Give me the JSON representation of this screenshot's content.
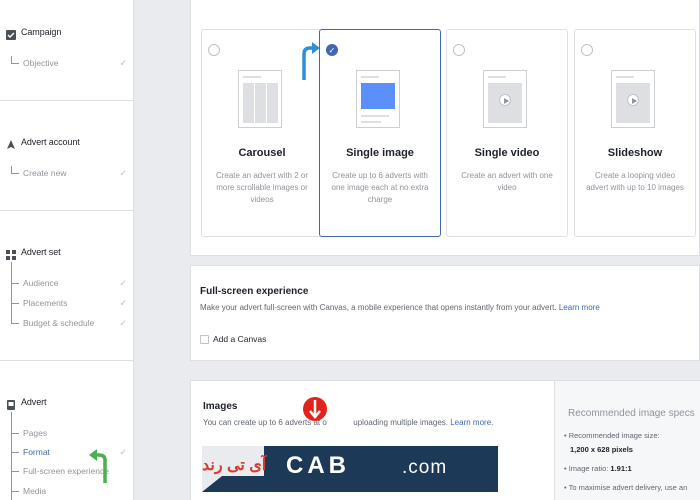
{
  "sidebar": {
    "campaign": {
      "label": "Campaign",
      "items": [
        {
          "label": "Objective"
        }
      ]
    },
    "advert_account": {
      "label": "Advert account",
      "items": [
        {
          "label": "Create new"
        }
      ]
    },
    "advert_set": {
      "label": "Advert set",
      "items": [
        {
          "label": "Audience"
        },
        {
          "label": "Placements"
        },
        {
          "label": "Budget & schedule"
        }
      ]
    },
    "advert": {
      "label": "Advert",
      "items": [
        {
          "label": "Pages"
        },
        {
          "label": "Format",
          "active": true
        },
        {
          "label": "Full-screen experience"
        },
        {
          "label": "Media"
        }
      ]
    },
    "check_glyph": "✓"
  },
  "formats": [
    {
      "title": "Carousel",
      "description": "Create an advert with 2 or more scrollable images or videos",
      "selected": false
    },
    {
      "title": "Single image",
      "description": "Create up to 6 adverts with one image each at no extra charge",
      "selected": true
    },
    {
      "title": "Single video",
      "description": "Create an advert with one video",
      "selected": false
    },
    {
      "title": "Slideshow",
      "description": "Create a looping video advert with up to 10 images",
      "selected": false
    }
  ],
  "fullscreen": {
    "title": "Full-screen experience",
    "description": "Make your advert full-screen with Canvas, a mobile experience that opens instantly from your advert.",
    "learn_more": "Learn more",
    "checkbox_label": "Add a Canvas"
  },
  "images": {
    "title": "Images",
    "description_start": "You can create up to 6 adverts at o",
    "description_end": "uploading multiple images.",
    "learn_more": "Learn more."
  },
  "recommended": {
    "title": "Recommended image specs",
    "size_label": "Recommended image size:",
    "size_value": "1,200 x 628 pixels",
    "ratio_label": "Image ratio:",
    "ratio_value": "1.91:1",
    "delivery_text": "To maximise advert delivery, use an"
  },
  "watermark": {
    "persian": "آی تی رند",
    "middle": "CAB",
    "brand": ".com"
  },
  "colors": {
    "accent": "#4267b2",
    "arrow_blue": "#2d8fd5",
    "arrow_green": "#4caf50",
    "arrow_red": "#e3231b"
  }
}
